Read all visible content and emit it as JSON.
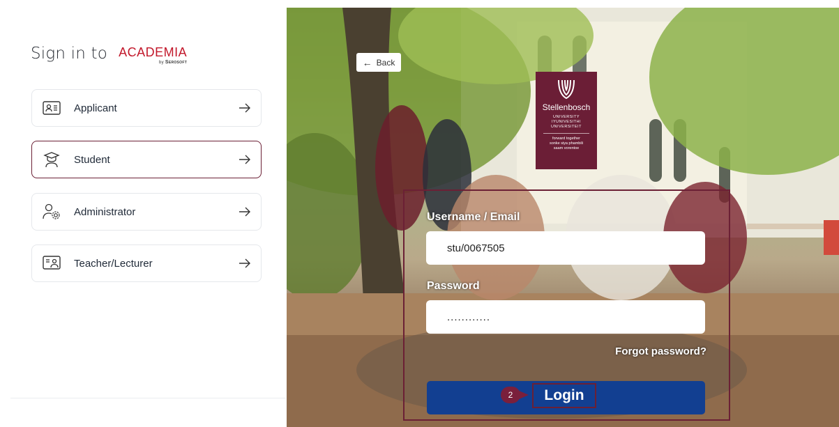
{
  "signin": {
    "prefix": "Sign in to",
    "brand_name": "ACADEMIA",
    "brand_by": "by",
    "brand_company": "Serosoft"
  },
  "roles": [
    {
      "label": "Applicant",
      "icon": "id-card-icon",
      "active": false
    },
    {
      "label": "Student",
      "icon": "graduate-icon",
      "active": true
    },
    {
      "label": "Administrator",
      "icon": "user-gear-icon",
      "active": false
    },
    {
      "label": "Teacher/Lecturer",
      "icon": "teacher-board-icon",
      "active": false
    }
  ],
  "back": {
    "label": "Back"
  },
  "university": {
    "name": "Stellenbosch",
    "line1": "UNIVERSITY",
    "line2": "IYUNIVESITHI",
    "line3": "UNIVERSITEIT",
    "tag1": "forward together",
    "tag2": "sonke siya phambili",
    "tag3": "saam vorentoe"
  },
  "form": {
    "username_label": "Username / Email",
    "username_value": "stu/0067505",
    "password_label": "Password",
    "password_value": "............",
    "forgot_label": "Forgot password?",
    "login_label": "Login",
    "step_badge": "2"
  },
  "colors": {
    "accent": "#6b2035",
    "brand_red": "#c2182b",
    "login_blue": "#123f91",
    "badge": "#7a1f3c"
  }
}
